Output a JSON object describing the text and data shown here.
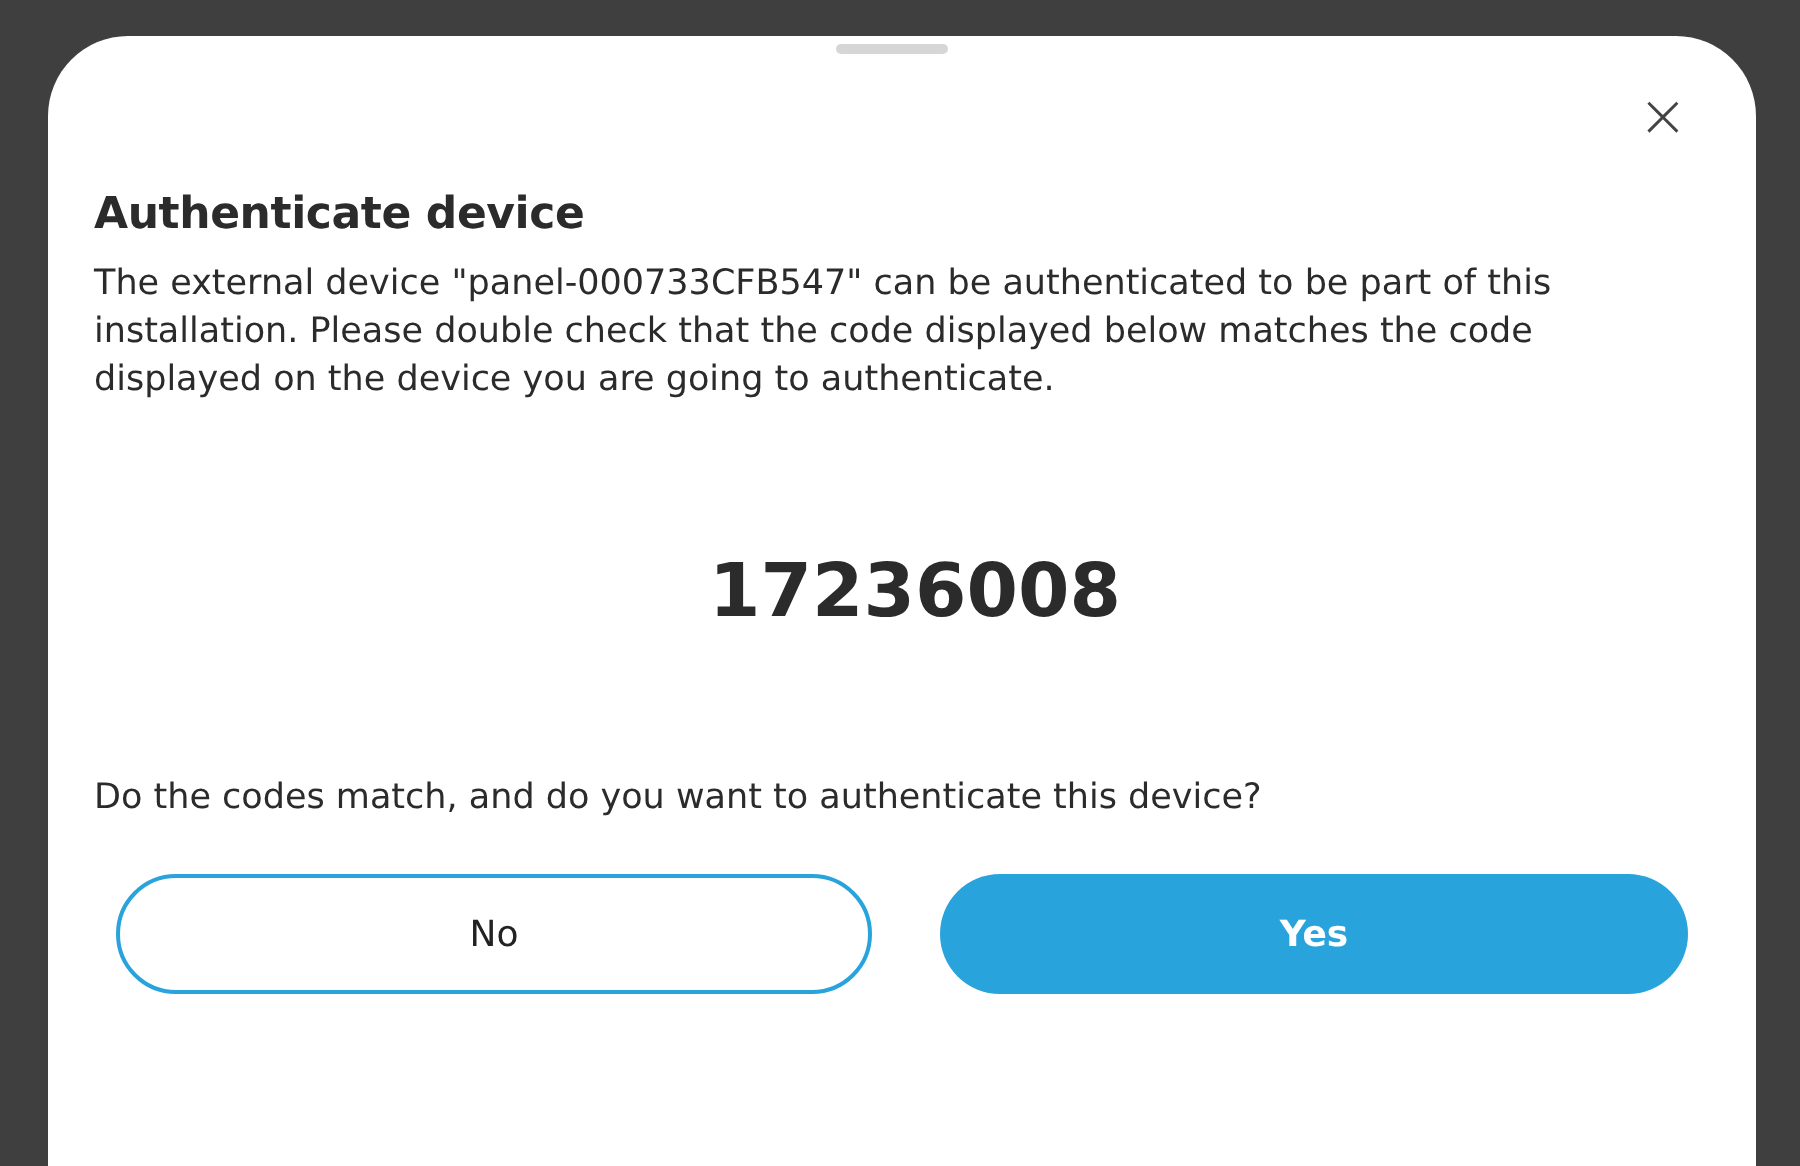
{
  "dialog": {
    "title": "Authenticate device",
    "close": "×",
    "message": "The external device \"panel-000733CFB547\" can be authenticated to be part of this installation. Please double check that the code displayed below matches the code displayed on the device you are going to authenticate.",
    "code": "17236008",
    "question": "Do the codes match, and do you want to authenticate this device?",
    "buttons": [
      {
        "label": "No",
        "kind": "secondary"
      },
      {
        "label": "Yes",
        "kind": "primary"
      }
    ]
  }
}
